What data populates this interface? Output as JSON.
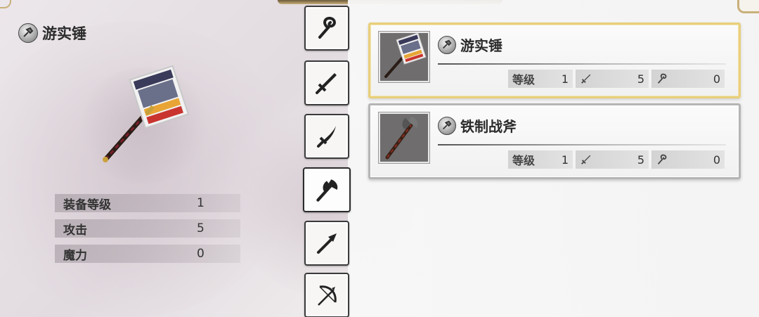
{
  "selected_item": {
    "name": "游实锤",
    "icon": "hammer-badge-icon",
    "stats": [
      {
        "label": "装备等级",
        "value": "1"
      },
      {
        "label": "攻击",
        "value": "5"
      },
      {
        "label": "魔力",
        "value": "0"
      }
    ]
  },
  "tabs": [
    {
      "id": "staff",
      "icon": "staff-icon"
    },
    {
      "id": "sword",
      "icon": "sword-icon"
    },
    {
      "id": "curved-blade",
      "icon": "curved-blade-icon"
    },
    {
      "id": "axe",
      "icon": "axe-icon",
      "active": true
    },
    {
      "id": "spear",
      "icon": "spear-icon"
    },
    {
      "id": "bow",
      "icon": "bow-icon"
    }
  ],
  "items": [
    {
      "name": "游实锤",
      "selected": true,
      "level_label": "等级",
      "level": "1",
      "attack": "5",
      "magic": "0"
    },
    {
      "name": "铁制战斧",
      "selected": false,
      "level_label": "等级",
      "level": "1",
      "attack": "5",
      "magic": "0"
    }
  ],
  "colors": {
    "selected_border": "#e8cf7a",
    "card_border": "#b5b5b5",
    "tab_border": "#3b3b3b"
  }
}
